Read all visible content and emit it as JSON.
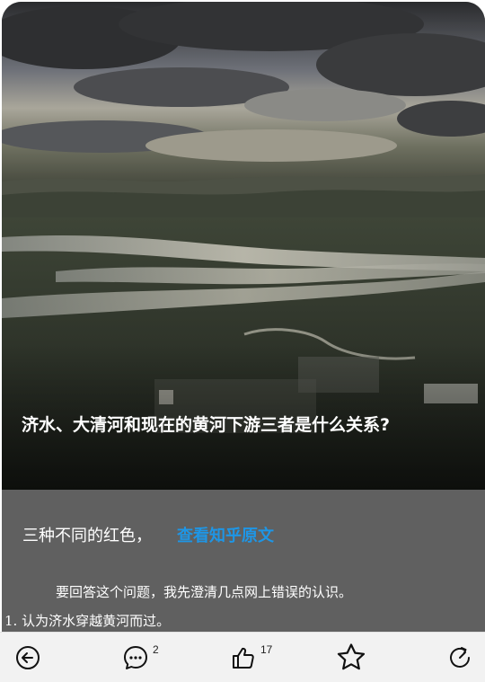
{
  "article": {
    "title": "济水、大清河和现在的黄河下游三者是什么关系?",
    "subtitle": "三种不同的红色，",
    "zhihu_link": "查看知乎原文",
    "paragraph_1": "要回答这个问题，我先澄清几点网上错误的认识。",
    "list_item_1": "1. 认为济水穿越黄河而过。"
  },
  "toolbar": {
    "back_icon": "back-arrow-icon",
    "comment_icon": "comment-bubble-icon",
    "comment_count": "2",
    "like_icon": "thumbs-up-icon",
    "like_count": "17",
    "favorite_icon": "star-icon",
    "share_icon": "share-icon"
  },
  "colors": {
    "link": "#1e96e6",
    "panel": "#606060",
    "toolbar": "#f2f2f2"
  }
}
